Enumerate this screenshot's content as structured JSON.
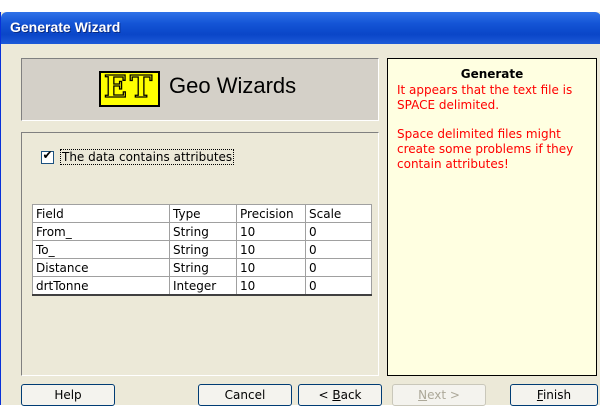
{
  "window": {
    "title": "Generate Wizard"
  },
  "logo": {
    "mark": "ET",
    "text": "Geo Wizards"
  },
  "options": {
    "checkbox_label": "The data contains attributes",
    "checked": true,
    "check_glyph": "✔"
  },
  "table": {
    "columns": [
      "Field",
      "Type",
      "Precision",
      "Scale"
    ],
    "rows": [
      [
        "From_",
        "String",
        "10",
        "0"
      ],
      [
        "To_",
        "String",
        "10",
        "0"
      ],
      [
        "Distance",
        "String",
        "10",
        "0"
      ],
      [
        "drtTonne",
        "Integer",
        "10",
        "0"
      ]
    ]
  },
  "info": {
    "heading": "Generate",
    "message1": "It appears that the text file is SPACE delimited.",
    "message2": "Space delimited files might create some problems if they contain attributes!"
  },
  "buttons": {
    "help": "Help",
    "cancel": "Cancel",
    "back_prefix": "< ",
    "back_key": "B",
    "back_rest": "ack",
    "next_key": "N",
    "next_rest": "ext >",
    "finish_key": "F",
    "finish_rest": "inish"
  },
  "colors": {
    "title_bar": "#0a46c8",
    "info_bg": "#ffffe1",
    "warning_text": "#ff0000",
    "logo_yellow": "#ffff00"
  }
}
